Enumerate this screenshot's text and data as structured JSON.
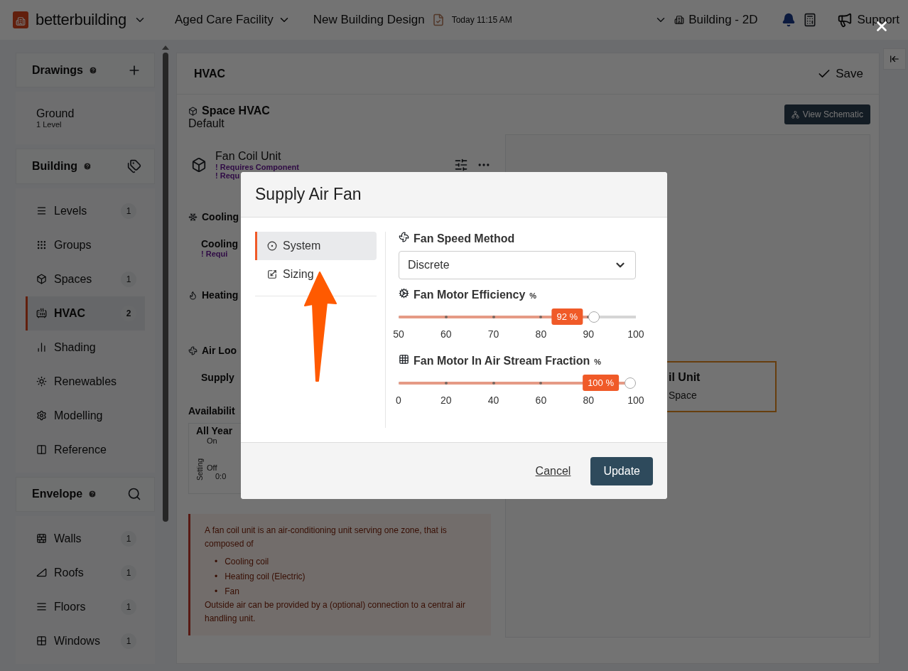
{
  "top_bar": {
    "brand": "betterbuilding",
    "project": "Aged Care Facility",
    "design": "New Building Design",
    "saved_time": "Today 11:15 AM",
    "view": "Building - 2D",
    "support": "Support"
  },
  "sidebar": {
    "sections": [
      {
        "title": "Drawings",
        "items": [
          {
            "kind": "drawing",
            "label": "Ground",
            "sublabel": "1 Level",
            "selected": false
          }
        ]
      },
      {
        "title": "Building",
        "items": [
          {
            "kind": "nav",
            "label": "Levels",
            "count": "1",
            "selected": false
          },
          {
            "kind": "nav",
            "label": "Groups",
            "selected": false
          },
          {
            "kind": "nav",
            "label": "Spaces",
            "count": "1",
            "selected": false
          },
          {
            "kind": "nav",
            "label": "HVAC",
            "count": "2",
            "selected": true
          },
          {
            "kind": "nav",
            "label": "Shading",
            "selected": false
          },
          {
            "kind": "nav",
            "label": "Renewables",
            "selected": false
          },
          {
            "kind": "nav",
            "label": "Modelling",
            "selected": false
          },
          {
            "kind": "nav",
            "label": "Reference",
            "selected": false
          }
        ]
      },
      {
        "title": "Envelope",
        "items": [
          {
            "kind": "nav",
            "label": "Walls",
            "count": "1",
            "selected": false
          },
          {
            "kind": "nav",
            "label": "Roofs",
            "count": "1",
            "selected": false
          },
          {
            "kind": "nav",
            "label": "Floors",
            "count": "1",
            "selected": false
          },
          {
            "kind": "nav",
            "label": "Windows",
            "count": "1",
            "selected": false
          }
        ]
      }
    ]
  },
  "main": {
    "title": "HVAC",
    "save": "Save",
    "view_schematic": "View Schematic",
    "space_hvac": {
      "title": "Space HVAC",
      "value": "Default"
    },
    "unit": {
      "name": "Fan Coil Unit",
      "warnings": [
        "! Requires Component",
        "! Requ"
      ]
    },
    "sections": [
      {
        "kind": "cooling",
        "title": "Cooling",
        "items": [
          {
            "name": "Cooling",
            "warnings": [
              "! Requi"
            ]
          }
        ]
      },
      {
        "kind": "heating",
        "title": "Heating"
      },
      {
        "kind": "air_loop",
        "title": "Air Loo",
        "items": [
          {
            "name": "Supply"
          }
        ]
      }
    ],
    "availability": {
      "title": "Availabilit",
      "chart_title": "All Year",
      "ylabel": "Setting",
      "yticks": [
        "On",
        "Off"
      ],
      "xtick": "0:0"
    },
    "info": {
      "intro": "A fan coil unit is an air-conditioning unit serving one zone, that is composed of",
      "list": [
        {
          "marker": "•",
          "text": "Cooling coil"
        },
        {
          "marker": "•",
          "text": "Heating coil (Electric)"
        },
        {
          "marker": "•",
          "text": "Fan"
        }
      ],
      "outro": "Outside air can be provided by a (optional) connection to a central air handling unit."
    },
    "diagram": {
      "name": "il Unit",
      "sub": "Space"
    }
  },
  "modal": {
    "title": "Supply Air Fan",
    "tabs": [
      {
        "label": "System",
        "selected": true
      },
      {
        "label": "Sizing",
        "selected": false
      }
    ],
    "fields": [
      {
        "kind": "select",
        "label": "Fan Speed Method",
        "value": "Discrete"
      },
      {
        "kind": "slider",
        "label": "Fan Motor Efficiency",
        "unit": "%",
        "value": "92 %",
        "level": 0.84,
        "ticks": [
          "50",
          "60",
          "70",
          "80",
          "90",
          "100"
        ]
      },
      {
        "kind": "slider",
        "label": "Fan Motor In Air Stream Fraction",
        "unit": "%",
        "value": "100 %",
        "level": 1,
        "ticks": [
          "0",
          "20",
          "40",
          "60",
          "80",
          "100"
        ]
      }
    ],
    "cancel": "Cancel",
    "submit": "Update"
  }
}
